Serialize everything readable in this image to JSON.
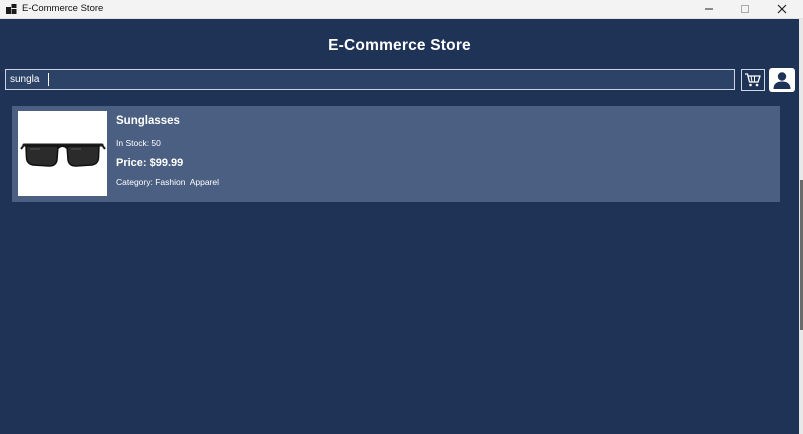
{
  "window": {
    "title": "E-Commerce Store",
    "controls": {
      "minimize": "—",
      "maximize": "☐",
      "close": "✕"
    }
  },
  "header": {
    "title": "E-Commerce Store"
  },
  "search": {
    "value": "sungla",
    "placeholder": ""
  },
  "icons": {
    "app": "app-windows-icon",
    "cart": "cart-icon",
    "user": "user-icon"
  },
  "product": {
    "name": "Sunglasses",
    "stock": "In Stock: 50",
    "price": "Price: $99.99",
    "category": "Category: Fashion  Apparel",
    "image": "sunglasses-image"
  },
  "colors": {
    "background": "#1f3357",
    "card": "#4b5f82",
    "search_field": "#2c4367",
    "titlebar": "#f3f3f3"
  }
}
